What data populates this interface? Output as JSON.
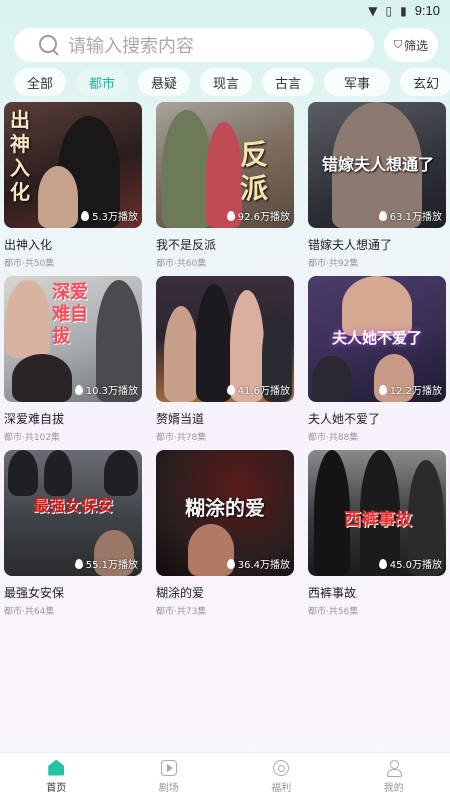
{
  "status_bar": {
    "time": "9:10"
  },
  "search": {
    "placeholder": "请输入搜索内容",
    "filter_label": "筛选"
  },
  "tabs": [
    {
      "label": "全部",
      "active": false
    },
    {
      "label": "都市",
      "active": true
    },
    {
      "label": "悬疑",
      "active": false
    },
    {
      "label": "现言",
      "active": false
    },
    {
      "label": "古言",
      "active": false
    },
    {
      "label": "军事",
      "active": false
    },
    {
      "label": "玄幻",
      "active": false
    }
  ],
  "dramas": [
    {
      "title": "出神入化",
      "meta": "都市·共50集",
      "plays": "5.3万播放",
      "cover_text": "出神入化",
      "cover_color": "#3a2a2a"
    },
    {
      "title": "我不是反派",
      "meta": "都市·共60集",
      "plays": "92.6万播放",
      "cover_text": "反派",
      "cover_color": "#7b6c5e"
    },
    {
      "title": "错嫁夫人想通了",
      "meta": "都市·共92集",
      "plays": "63.1万播放",
      "cover_text": "错嫁夫人想通了",
      "cover_color": "#2f3038"
    },
    {
      "title": "深爱难自拔",
      "meta": "都市·共102集",
      "plays": "10.3万播放",
      "cover_text": "深爱难自拔",
      "cover_color": "#8a8f96"
    },
    {
      "title": "赘婿当道",
      "meta": "都市·共78集",
      "plays": "41.6万播放",
      "cover_text": "",
      "cover_color": "#2b2530"
    },
    {
      "title": "夫人她不爱了",
      "meta": "都市·共88集",
      "plays": "12.2万播放",
      "cover_text": "夫人她不爱了",
      "cover_color": "#3b2f57"
    },
    {
      "title": "最强女安保",
      "meta": "都市·共64集",
      "plays": "55.1万播放",
      "cover_text": "最强女保安",
      "cover_color": "#3e4246"
    },
    {
      "title": "糊涂的爱",
      "meta": "都市·共73集",
      "plays": "36.4万播放",
      "cover_text": "糊涂的爱",
      "cover_color": "#2a1f1f"
    },
    {
      "title": "西裤事故",
      "meta": "都市·共56集",
      "plays": "45.0万播放",
      "cover_text": "西裤事故",
      "cover_color": "#3a3a3a"
    }
  ],
  "bottom_nav": [
    {
      "label": "首页",
      "icon": "home-icon",
      "active": true
    },
    {
      "label": "剧场",
      "icon": "play-icon",
      "active": false
    },
    {
      "label": "福利",
      "icon": "gift-icon",
      "active": false
    },
    {
      "label": "我的",
      "icon": "user-icon",
      "active": false
    }
  ],
  "colors": {
    "accent": "#1fb39a"
  }
}
